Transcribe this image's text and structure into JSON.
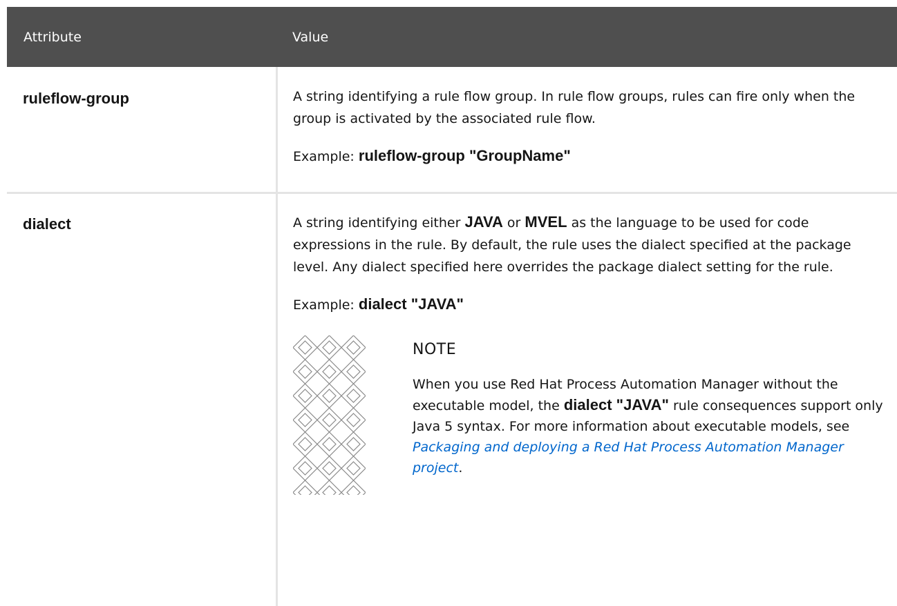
{
  "header": {
    "attribute": "Attribute",
    "value": "Value"
  },
  "rows": [
    {
      "name": "ruleflow-group",
      "description": "A string identifying a rule flow group. In rule flow groups, rules can fire only when the group is activated by the associated rule flow.",
      "example_label": "Example:",
      "example_code": "ruleflow-group \"GroupName\""
    },
    {
      "name": "dialect",
      "desc_part1": "A string identifying either",
      "desc_code1": "JAVA",
      "desc_part2": "or",
      "desc_code2": "MVEL",
      "desc_part3": "as the language to be used for code expressions in the rule. By default, the rule uses the dialect specified at the package level. Any dialect specified here overrides the package dialect setting for the rule.",
      "example_label": "Example:",
      "example_code": "dialect \"JAVA\"",
      "note": {
        "title": "NOTE",
        "text1": "When you use Red Hat Process Automation Manager without the executable model, the",
        "code": "dialect \"JAVA\"",
        "text2": "rule consequences support only Java 5 syntax. For more information about executable models, see",
        "link": "Packaging and deploying a Red Hat Process Automation Manager project",
        "text3": "."
      }
    }
  ],
  "icons": {
    "note_icon": "note-pattern-icon"
  },
  "colors": {
    "header_bg": "#4f4f4f",
    "link": "#0066cc",
    "divider": "#e4e4e4"
  }
}
